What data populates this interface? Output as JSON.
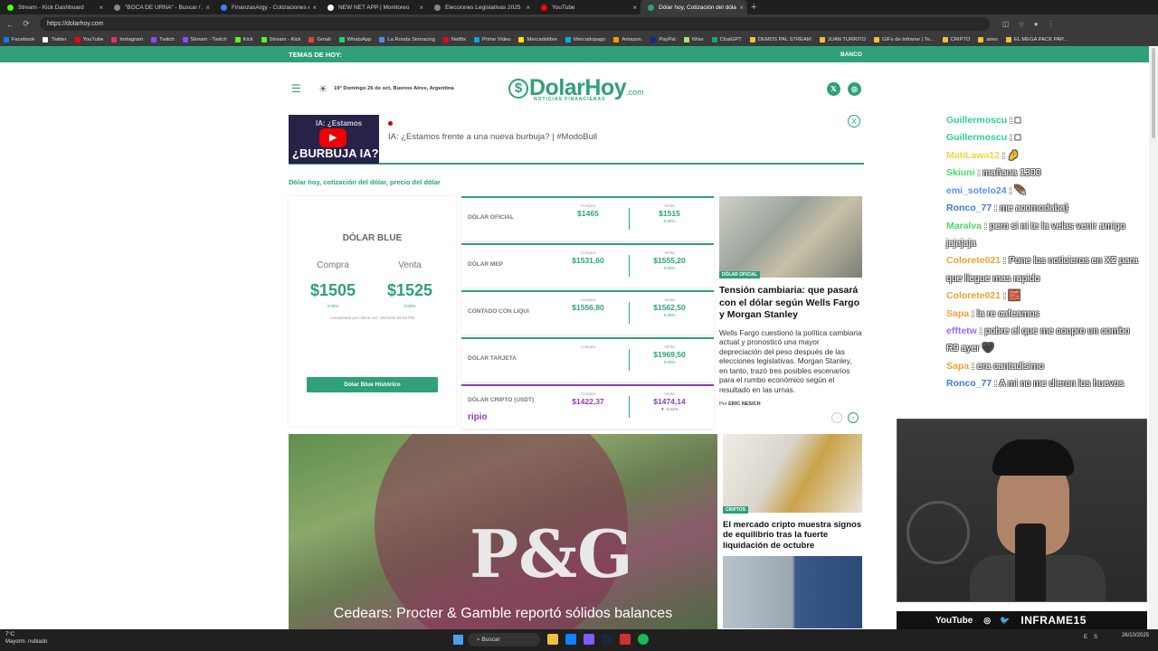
{
  "browser": {
    "tabs": [
      {
        "label": "Stream - Kick Dashboard",
        "color": "#53fc18"
      },
      {
        "label": "\"BOCA DE URNA\" - Buscar / X",
        "color": "#888888"
      },
      {
        "label": "FinanzasArgy - Cotizaciones en ti",
        "color": "#3b82f6"
      },
      {
        "label": "NEW NET APP | Monitoreo",
        "color": "#ffffff"
      },
      {
        "label": "Elecciones Legislativas 2025",
        "color": "#888888"
      },
      {
        "label": "YouTube",
        "color": "#ff0000"
      },
      {
        "label": "Dólar hoy, Cotización del dólar |",
        "color": "#2fa07a"
      }
    ],
    "url": "https://dolarhoy.com",
    "bookmarks": [
      "Facebook",
      "Twitter",
      "YouTube",
      "Instagram",
      "Twitch",
      "Stream - Twitch",
      "Kick",
      "Stream - Kick",
      "Gmail",
      "WhatsApp",
      "La Ronda Simracing",
      "Netflix",
      "Prime Video",
      "Mercadolibre",
      "Mercadopago",
      "Amazon.",
      "PayPal",
      "Wise",
      "ChatGPT",
      "DEMOS PAL STREAM",
      "JUAN TURRITO",
      "GIFs de Inframe | Te...",
      "CRIPTO",
      "aires",
      "EL MEGA PACK PAP..."
    ]
  },
  "topics": {
    "label": "TEMAS DE HOY:",
    "item": "BANCO"
  },
  "header": {
    "weather": "19° Domingo 26 de oct, Buenos Aires, Argentina",
    "logo": "DolarHoy",
    "logo_suffix": ".com",
    "logo_tagline": "NOTICIAS FINANCIERAS"
  },
  "video": {
    "title": "IA: ¿Estamos frente a una nueva burbuja? | #ModoBull",
    "thumb_text": "¿BURBUJA IA?",
    "thumb_sub": "IA: ¿Estamos"
  },
  "breadcrumb": "Dólar hoy, cotización del dólar, precio del dólar",
  "blue": {
    "title": "DÓLAR BLUE",
    "buy_label": "Compra",
    "sell_label": "Venta",
    "buy": "$1505",
    "sell": "$1525",
    "buy_pct": "0.00%",
    "sell_pct": "0.00%",
    "updated": "Actualizado por última vez: 26/10/25 08:59 PM",
    "button": "Dólar Blue Histórico"
  },
  "rates": [
    {
      "name": "DÓLAR OFICIAL",
      "buy": "$1465",
      "sell": "$1515",
      "pct": "0.00%"
    },
    {
      "name": "DÓLAR MEP",
      "buy": "$1531,60",
      "sell": "$1555,20",
      "pct": "0.00%"
    },
    {
      "name": "CONTADO CON LIQUI",
      "buy": "$1556,80",
      "sell": "$1562,50",
      "pct": "0.00%"
    },
    {
      "name": "DÓLAR TARJETA",
      "buy": "",
      "sell": "$1969,50",
      "pct": "0.00%"
    },
    {
      "name": "DÓLAR CRIPTO (USDT)",
      "buy": "$1422,37",
      "sell": "$1474,14",
      "pct": "▼ -0.11%",
      "brand": "ripio"
    }
  ],
  "rate_labels": {
    "buy": "Compra",
    "sell": "Venta"
  },
  "news_main": {
    "tag": "DÓLAR OFICIAL",
    "headline": "Tensión cambiaria: que pasará con el dólar según Wells Fargo y Morgan Stanley",
    "body": "Wells Fargo cuestionó la política cambiaria actual y pronosticó una mayor depreciación del peso después de las elecciones legislativas. Morgan Stanley, en tanto, trazó tres posibles escenarios para el rumbo económico según el resultado en las urnas.",
    "by_label": "Por",
    "author": "ERIC NESICH"
  },
  "feature": {
    "logo": "P&G",
    "caption": "Cedears: Procter & Gamble reportó sólidos balances"
  },
  "news_side": {
    "tag": "CRIPTOS",
    "headline": "El mercado cripto muestra signos de equilibrio tras la fuerte liquidación de octubre"
  },
  "chat": [
    {
      "user": "Guillermoscu",
      "color": "#2fcf8f",
      "text": ": ■"
    },
    {
      "user": "Guillermoscu",
      "color": "#2fcf8f",
      "text": ": ■"
    },
    {
      "user": "MatiLawa12",
      "color": "#f0d53a",
      "text": ": 🤌"
    },
    {
      "user": "Skiuni",
      "color": "#4cd964",
      "text": ": mañana 1300"
    },
    {
      "user": "emi_sotelo24",
      "color": "#5b8cff",
      "text": ": 🪶"
    },
    {
      "user": "Ronco_77",
      "color": "#3a7bd5",
      "text": ": me acomodaba}"
    },
    {
      "user": "Maralva",
      "color": "#4cd964",
      "text": ": pero si ni te la velas venir amigo jajajaja"
    },
    {
      "user": "Colorete021",
      "color": "#f0a030",
      "text": ": Pone los noticieros en X2 para que llegue mas rapido"
    },
    {
      "user": "Colorete021",
      "color": "#f0a030",
      "text": ": 🧱"
    },
    {
      "user": "Sapa",
      "color": "#f0a030",
      "text": ": la re cafeamos"
    },
    {
      "user": "efftetw",
      "color": "#9b6bff",
      "text": ": pobre el que me coupro un combo R9 ayer 🖤"
    },
    {
      "user": "Sapa",
      "color": "#f0a030",
      "text": ": era cantadisimo"
    },
    {
      "user": "Ronco_77",
      "color": "#3a7bd5",
      "text": ": A mi no me dieron los huevos"
    }
  ],
  "cam": {
    "yt": "YouTube",
    "name": "INFRAME15"
  },
  "taskbar": {
    "weather_temp": "7°C",
    "weather_desc": "Mayorm. nublado",
    "search": "Buscar",
    "lang": "ES",
    "date": "26/10/2025"
  }
}
